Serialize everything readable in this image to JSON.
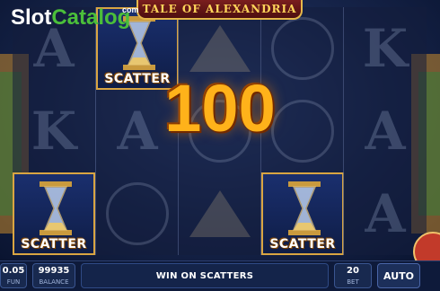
{
  "watermark": {
    "part1": "Slot",
    "part2": "Catalog",
    "suffix": "com"
  },
  "game": {
    "title": "TALE OF ALEXANDRIA"
  },
  "win": {
    "amount": "100"
  },
  "reels": [
    [
      {
        "type": "letter",
        "text": "A"
      },
      {
        "type": "letter",
        "text": "K"
      },
      {
        "type": "scatter",
        "label": "SCATTER"
      }
    ],
    [
      {
        "type": "scatter",
        "label": "SCATTER"
      },
      {
        "type": "letter",
        "text": "A"
      },
      {
        "type": "circle"
      }
    ],
    [
      {
        "type": "pyramid"
      },
      {
        "type": "circle"
      },
      {
        "type": "pyramid"
      }
    ],
    [
      {
        "type": "circle"
      },
      {
        "type": "circle"
      },
      {
        "type": "scatter",
        "label": "SCATTER"
      }
    ],
    [
      {
        "type": "letter",
        "text": "K"
      },
      {
        "type": "letter",
        "text": "A"
      },
      {
        "type": "letter",
        "text": "A"
      }
    ]
  ],
  "bottom_bar": {
    "fun_value": "0.05",
    "fun_label": "FUN",
    "balance_value": "99935",
    "balance_label": "BALANCE",
    "message": "WIN ON SCATTERS",
    "bet_value": "20",
    "bet_label": "BET",
    "auto_label": "AUTO"
  },
  "colors": {
    "win_gold": "#ffb21a",
    "frame_gold": "#d9a542",
    "watermark_green": "#4bbf3a"
  }
}
